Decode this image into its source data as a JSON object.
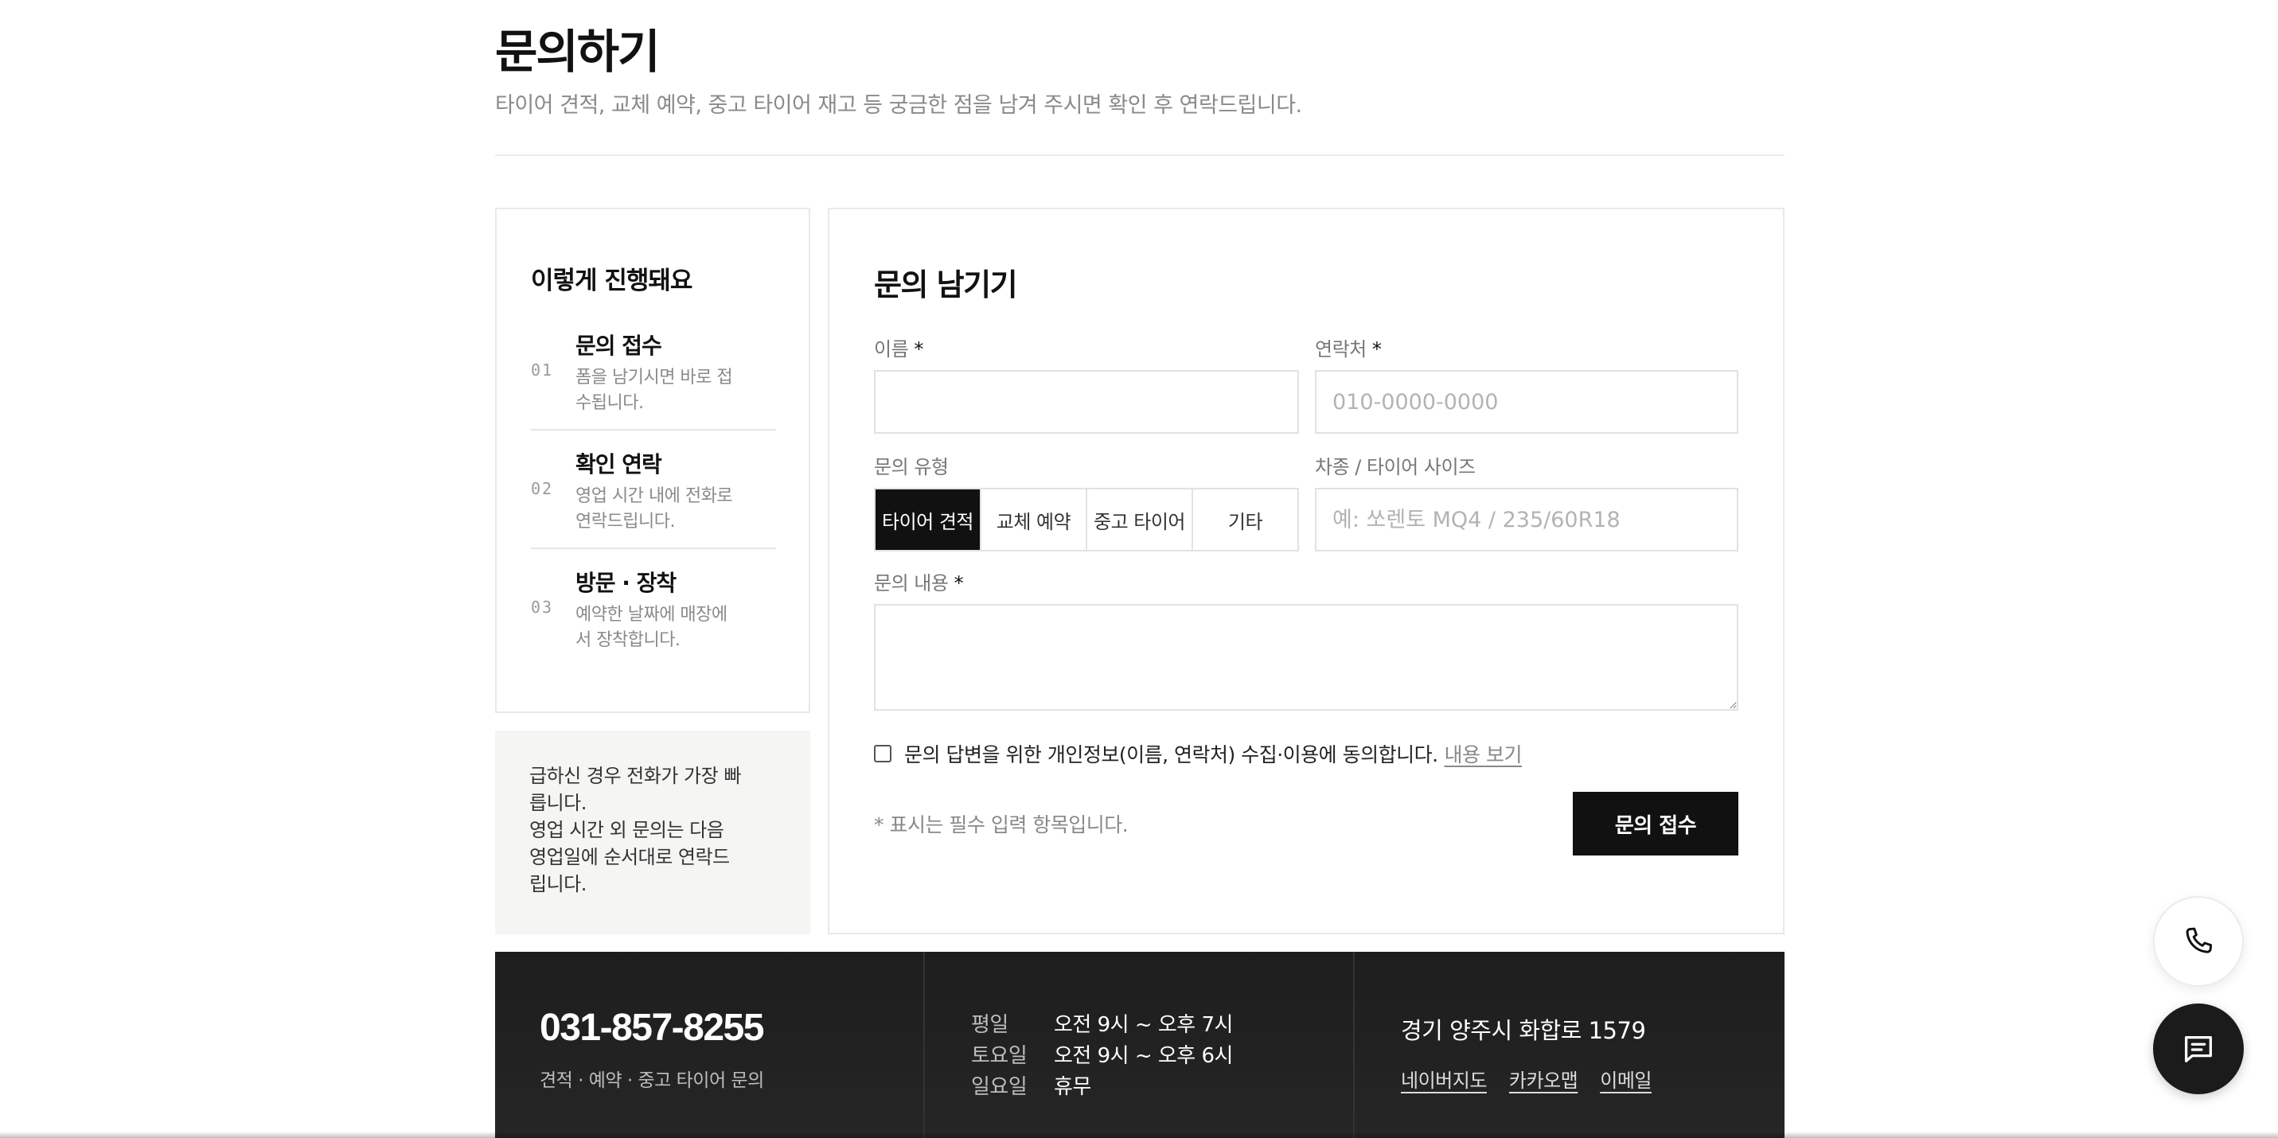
{
  "header": {
    "title": "문의하기",
    "subtitle": "타이어 견적, 교체 예약, 중고 타이어 재고 등 궁금한 점을 남겨 주시면 확인 후 연락드립니다."
  },
  "steps": {
    "title": "이렇게 진행돼요",
    "items": [
      {
        "num": "01",
        "name": "문의 접수",
        "desc": "폼을 남기시면 바로 접수됩니다."
      },
      {
        "num": "02",
        "name": "확인 연락",
        "desc": "영업 시간 내에 전화로 연락드립니다."
      },
      {
        "num": "03",
        "name": "방문 · 장착",
        "desc": "예약한 날짜에 매장에서 장착합니다."
      }
    ]
  },
  "note": {
    "line1": "급하신 경우 전화가 가장 빠릅니다.",
    "line2": "영업 시간 외 문의는 다음 영업일에 순서대로 연락드립니다."
  },
  "form": {
    "title": "문의 남기기",
    "name_label": "이름",
    "phone_label": "연락처",
    "phone_placeholder": "010-0000-0000",
    "required_mark": "*",
    "type_label": "문의 유형",
    "types": [
      "타이어 견적",
      "교체 예약",
      "중고 타이어",
      "기타"
    ],
    "selected_type": "타이어 견적",
    "vehicle_label": "차종 / 타이어 사이즈",
    "vehicle_placeholder": "예: 쏘렌토 MQ4 / 235/60R18",
    "content_label": "문의 내용",
    "consent_text": "문의 답변을 위한 개인정보(이름, 연락처) 수집·이용에 동의합니다.",
    "consent_link": "내용 보기",
    "required_note": "* 표시는 필수 입력 항목입니다.",
    "submit_label": "문의 접수"
  },
  "footer": {
    "phone": "031-857-8255",
    "phone_sub": "견적 · 예약 · 중고 타이어 문의",
    "hours": [
      {
        "day": "평일",
        "time": "오전 9시 ~ 오후 7시"
      },
      {
        "day": "토요일",
        "time": "오전 9시 ~ 오후 6시"
      },
      {
        "day": "일요일",
        "time": "휴무"
      }
    ],
    "address": "경기 양주시 화합로 1579",
    "links": [
      "네이버지도",
      "카카오맵",
      "이메일"
    ]
  },
  "floating": {
    "phone_icon": "phone-icon",
    "chat_icon": "chat-icon"
  }
}
